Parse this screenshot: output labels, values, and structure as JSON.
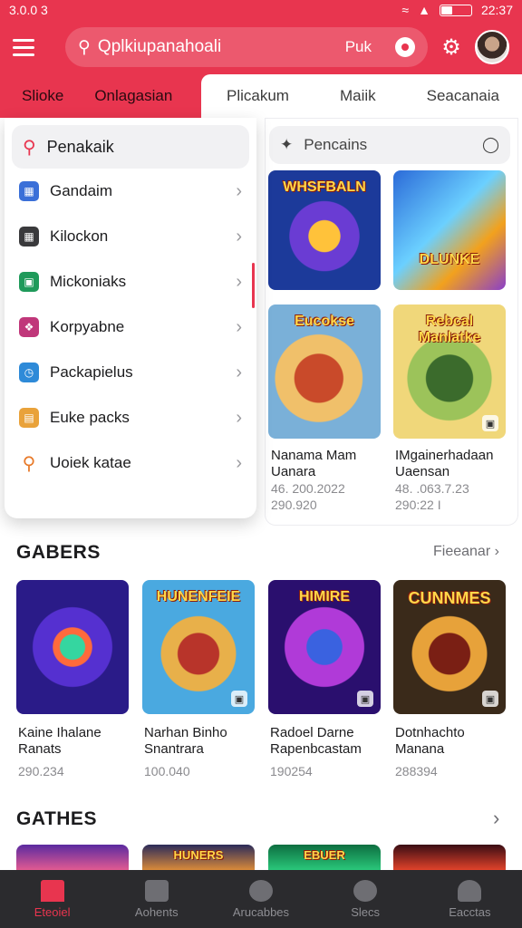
{
  "status": {
    "time_left": "3.0.0 3",
    "time_right": "22:37"
  },
  "header": {
    "search_text": "Qplkiupanahoali",
    "search_extra": "Puk"
  },
  "tabs": [
    "Slioke",
    "Onlagasian",
    "Plicakum",
    "Maiik",
    "Seacanaia"
  ],
  "drawer": {
    "search_label": "Penakaik",
    "items": [
      {
        "label": "Gandaim",
        "icon": "grid-icon",
        "color": "#3a6fd8"
      },
      {
        "label": "Kilockon",
        "icon": "calendar-icon",
        "color": "#3a3a3c"
      },
      {
        "label": "Mickoniaks",
        "icon": "stack-icon",
        "color": "#1f9a5a"
      },
      {
        "label": "Korpyabne",
        "icon": "puzzle-icon",
        "color": "#c0377a"
      },
      {
        "label": "Packapielus",
        "icon": "clock-icon",
        "color": "#2e8ad8"
      },
      {
        "label": "Euke packs",
        "icon": "box-icon",
        "color": "#e9a23a"
      },
      {
        "label": "Uoiek katae",
        "icon": "search-icon",
        "color": "#e87a2a"
      }
    ]
  },
  "right_panel": {
    "search_label": "Pencains",
    "cards": [
      {
        "banner": "WHSFBALN",
        "name": "",
        "sub": "",
        "meta1": "",
        "meta2": ""
      },
      {
        "banner": "DLUNKE",
        "name": "",
        "sub": "",
        "meta1": "",
        "meta2": ""
      },
      {
        "banner": "Eucokse",
        "name": "Nanama Mam",
        "sub": "Uanara",
        "meta1": "46. 200.2022",
        "meta2": "290.920"
      },
      {
        "banner": "Rebcal Manlatke",
        "name": "IMgainerhadaan",
        "sub": "Uaensan",
        "meta1": "48. .063.7.23",
        "meta2": "290:22 I"
      }
    ]
  },
  "section1": {
    "title": "GABERS",
    "more_label": "Fieeanar",
    "cards": [
      {
        "banner": "",
        "name": "Kaine Ihalane",
        "sub": "Ranats",
        "meta": "290.234"
      },
      {
        "banner": "HUNENFEIE",
        "name": "Narhan Binho",
        "sub": "Snantrara",
        "meta": "100.040"
      },
      {
        "banner": "HIMIRE",
        "name": "Radoel Darne",
        "sub": "Rapenbcastam",
        "meta": "190254"
      },
      {
        "banner": "CUNNMES",
        "name": "Dotnhachto",
        "sub": "Manana",
        "meta": "288394"
      }
    ]
  },
  "section2": {
    "title": "GATHES",
    "cards": [
      {
        "banner": ""
      },
      {
        "banner": "HUNERS"
      },
      {
        "banner": "EBUER"
      },
      {
        "banner": ""
      }
    ]
  },
  "bottom_nav": [
    {
      "label": "Eteoiel",
      "active": true
    },
    {
      "label": "Aohents",
      "active": false
    },
    {
      "label": "Arucabbes",
      "active": false
    },
    {
      "label": "Slecs",
      "active": false
    },
    {
      "label": "Eacctas",
      "active": false
    }
  ]
}
